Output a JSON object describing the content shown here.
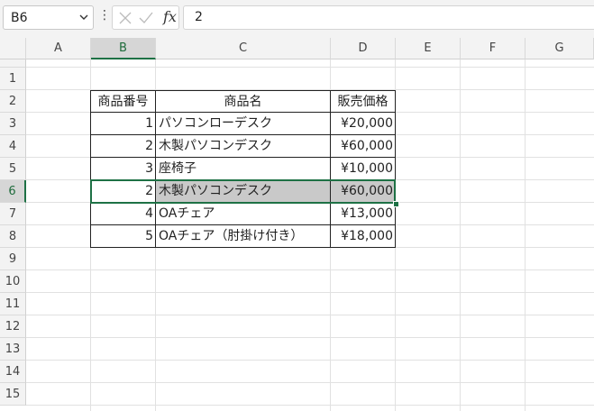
{
  "formula_bar": {
    "name_box": "B6",
    "formula": "2",
    "fx": "fx"
  },
  "columns": [
    "A",
    "B",
    "C",
    "D",
    "E",
    "F",
    "G"
  ],
  "rows": [
    "1",
    "2",
    "3",
    "4",
    "5",
    "6",
    "7",
    "8",
    "9",
    "10",
    "11",
    "12",
    "13",
    "14",
    "15"
  ],
  "selection": {
    "row": "6",
    "column": "B"
  },
  "table": {
    "headers": [
      "商品番号",
      "商品名",
      "販売価格"
    ],
    "rows": [
      {
        "id": "1",
        "name": "パソコンローデスク",
        "price": "¥20,000"
      },
      {
        "id": "2",
        "name": "木製パソコンデスク",
        "price": "¥60,000"
      },
      {
        "id": "3",
        "name": "座椅子",
        "price": "¥10,000"
      },
      {
        "id": "2",
        "name": "木製パソコンデスク",
        "price": "¥60,000"
      },
      {
        "id": "4",
        "name": "OAチェア",
        "price": "¥13,000"
      },
      {
        "id": "5",
        "name": "OAチェア（肘掛け付き）",
        "price": "¥18,000"
      }
    ]
  },
  "colors": {
    "selection_accent": "#1e7145",
    "highlight_fill": "#c9c9c9"
  },
  "icons": [
    "chevron-down-icon",
    "more-options-icon",
    "cancel-icon",
    "enter-icon",
    "fx-icon"
  ]
}
